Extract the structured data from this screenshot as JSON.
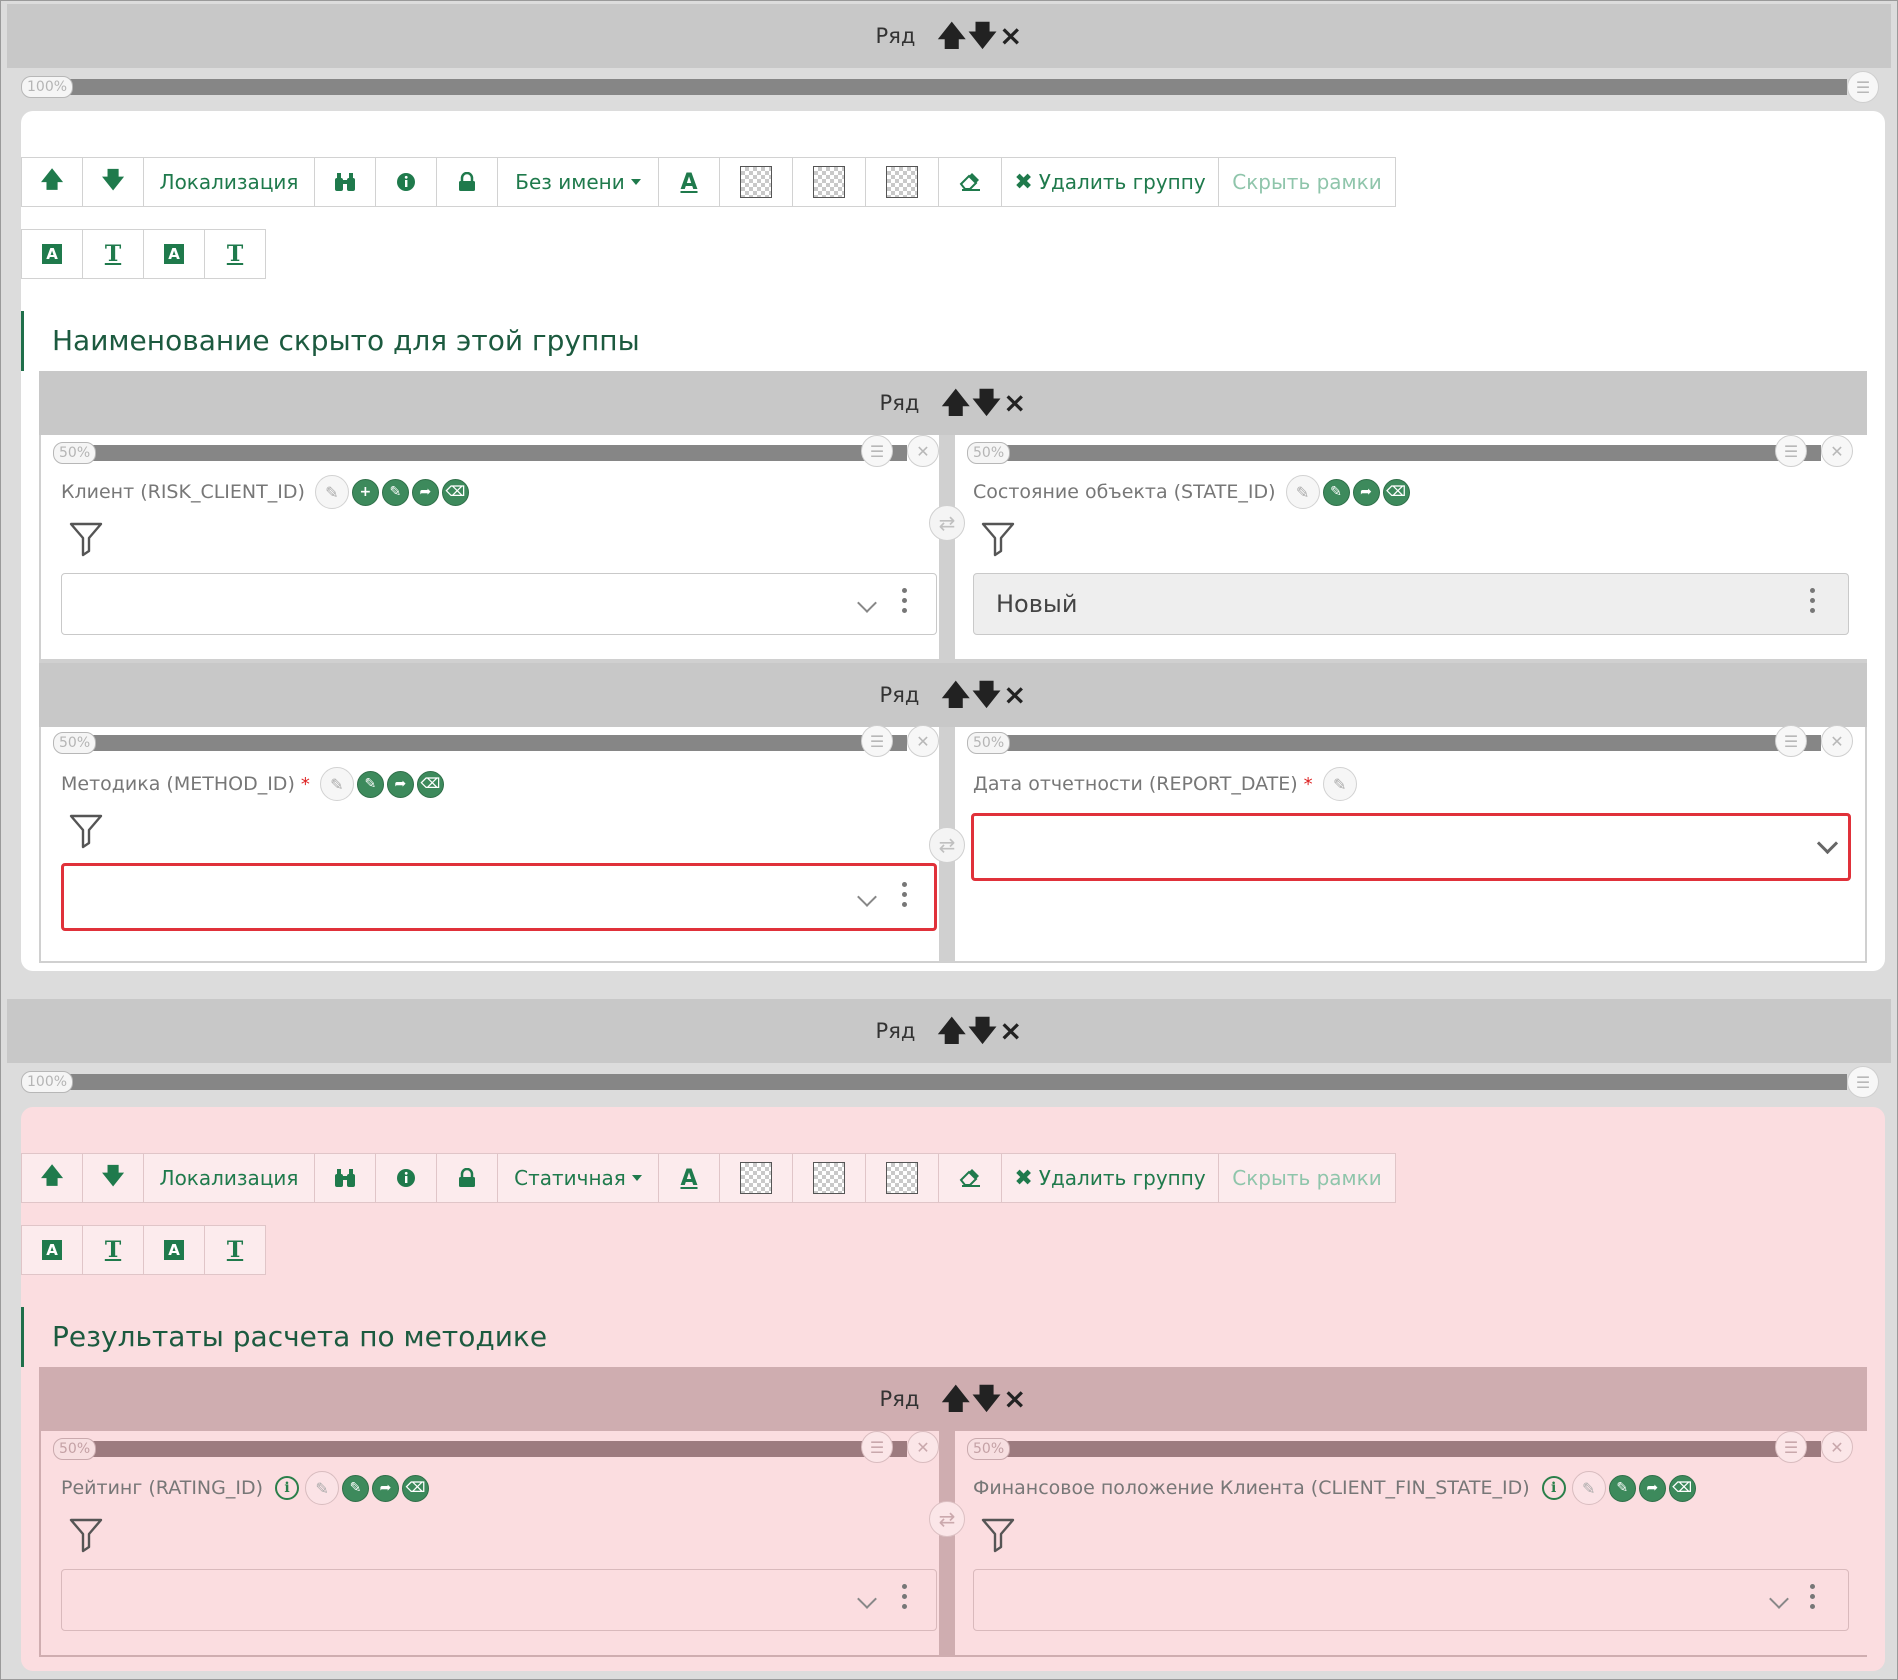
{
  "rows": {
    "row_label": "Ряд",
    "controls": [
      "🡅",
      "🡇",
      "×"
    ]
  },
  "width_labels": {
    "full": "100%",
    "half": "50%"
  },
  "groups": [
    {
      "toolbar": {
        "up": "🡅",
        "down": "🡇",
        "localization": "Локализация",
        "name_mode": "Без имени",
        "delete_group": "Удалить группу",
        "hide_frames": "Скрыть рамки"
      },
      "title": "Наименование скрыто для этой группы",
      "fields": [
        {
          "label": "Клиент (RISK_CLIENT_ID)",
          "value": "",
          "required": false
        },
        {
          "label": "Состояние объекта (STATE_ID)",
          "value": "Новый",
          "required": false
        },
        {
          "label": "Методика (METHOD_ID)",
          "value": "",
          "required": true
        },
        {
          "label": "Дата отчетности (REPORT_DATE)",
          "value": "",
          "required": true
        }
      ]
    },
    {
      "toolbar": {
        "up": "🡅",
        "down": "🡇",
        "localization": "Локализация",
        "name_mode": "Статичная",
        "delete_group": "Удалить группу",
        "hide_frames": "Скрыть рамки"
      },
      "title": "Результаты расчета по методике",
      "fields": [
        {
          "label": "Рейтинг (RATING_ID)",
          "value": "",
          "required": false
        },
        {
          "label": "Финансовое положение Клиента (CLIENT_FIN_STATE_ID)",
          "value": "",
          "required": false
        }
      ]
    }
  ],
  "required_mark": "*",
  "colors": {
    "accent": "#1f7a4c",
    "error": "#e0313a",
    "pink_panel": "#fbdde0",
    "row_grey": "#c8c8c8"
  }
}
